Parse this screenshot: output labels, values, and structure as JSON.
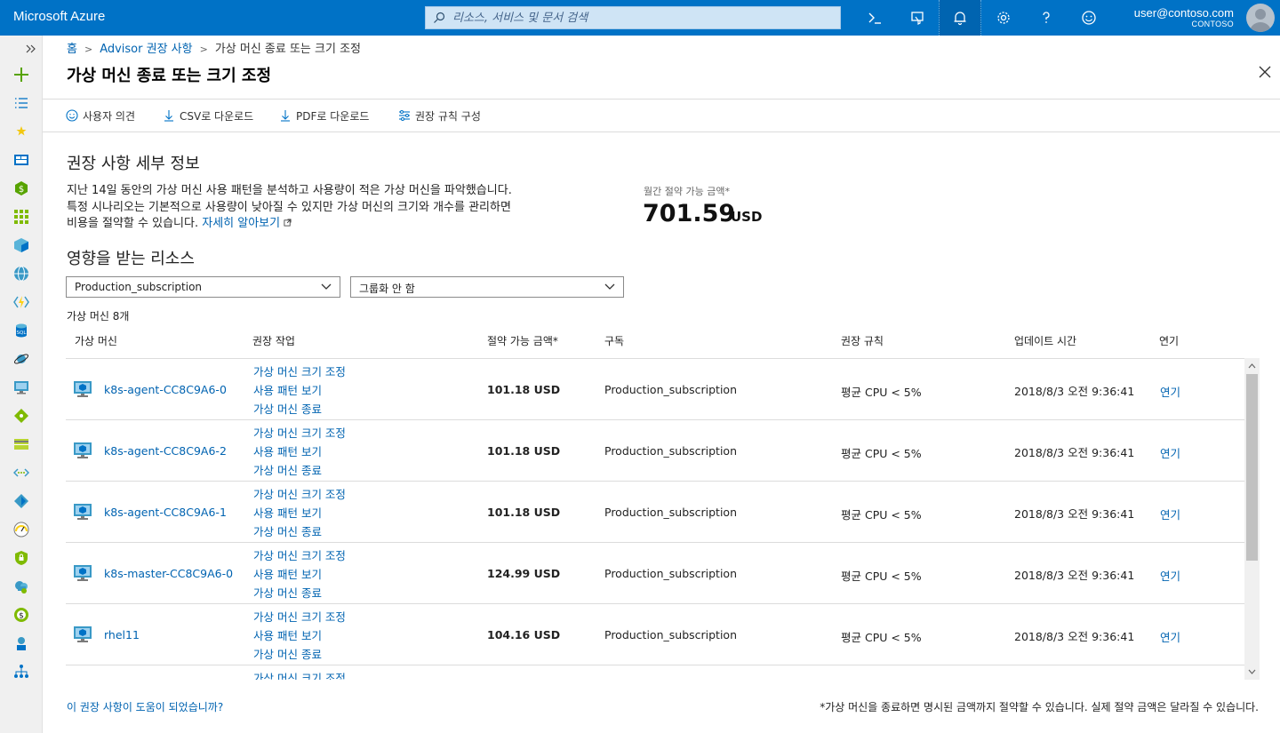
{
  "topbar": {
    "brand": "Microsoft Azure",
    "search_placeholder": "리소스, 서비스 및 문서 검색",
    "user_email": "user@contoso.com",
    "user_org": "CONTOSO",
    "accent": "#0072c6"
  },
  "breadcrumb": {
    "home": "홈",
    "advisor": "Advisor 권장 사항",
    "current": "가상 머신 종료 또는 크기 조정"
  },
  "blade": {
    "title": "가상 머신 종료 또는 크기 조정"
  },
  "toolbar": {
    "feedback": "사용자 의견",
    "csv": "CSV로 다운로드",
    "pdf": "PDF로 다운로드",
    "configure": "권장 규칙 구성"
  },
  "details": {
    "heading": "권장 사항 세부 정보",
    "line1": "지난 14일 동안의 가상 머신 사용 패턴을 분석하고 사용량이 적은 가상 머신을 파악했습니다.",
    "line2": "특정 시나리오는 기본적으로 사용량이 낮아질 수 있지만 가상 머신의 크기와 개수를 관리하면",
    "line3": "비용을 절약할 수 있습니다.",
    "learn_more": "자세히 알아보기",
    "savings_label": "월간 절약 가능 금액*",
    "savings_amount": "701.59",
    "savings_currency": "USD"
  },
  "resources": {
    "heading": "영향을 받는 리소스",
    "subscription_select": "Production_subscription",
    "grouping_select": "그룹화 안 함",
    "count": "가상 머신 8개",
    "columns": {
      "vm": "가상 머신",
      "action": "권장 작업",
      "savings": "절약 가능 금액*",
      "subscription": "구독",
      "rule": "권장 규칙",
      "updated": "업데이트 시간",
      "postpone": "연기"
    },
    "action_labels": [
      "가상 머신 크기 조정",
      "사용 패턴 보기",
      "가상 머신 종료"
    ],
    "rows": [
      {
        "name": "k8s-agent-CC8C9A6-0",
        "savings": "101.18 USD",
        "subscription": "Production_subscription",
        "rule": "평균 CPU < 5%",
        "updated": "2018/8/3 오전 9:36:41",
        "postpone": "연기"
      },
      {
        "name": "k8s-agent-CC8C9A6-2",
        "savings": "101.18 USD",
        "subscription": "Production_subscription",
        "rule": "평균 CPU < 5%",
        "updated": "2018/8/3 오전 9:36:41",
        "postpone": "연기"
      },
      {
        "name": "k8s-agent-CC8C9A6-1",
        "savings": "101.18 USD",
        "subscription": "Production_subscription",
        "rule": "평균 CPU < 5%",
        "updated": "2018/8/3 오전 9:36:41",
        "postpone": "연기"
      },
      {
        "name": "k8s-master-CC8C9A6-0",
        "savings": "124.99 USD",
        "subscription": "Production_subscription",
        "rule": "평균 CPU < 5%",
        "updated": "2018/8/3 오전 9:36:41",
        "postpone": "연기"
      },
      {
        "name": "rhel11",
        "savings": "104.16 USD",
        "subscription": "Production_subscription",
        "rule": "평균 CPU < 5%",
        "updated": "2018/8/3 오전 9:36:41",
        "postpone": "연기"
      },
      {
        "name": "",
        "savings": "",
        "subscription": "",
        "rule": "",
        "updated": "",
        "postpone": ""
      }
    ]
  },
  "footer": {
    "helpful": "이 권장 사항이 도움이 되었습니까?",
    "note": "*가상 머신을 종료하면 명시된 금액까지 절약할 수 있습니다. 실제 절약 금액은 달라질 수 있습니다."
  }
}
